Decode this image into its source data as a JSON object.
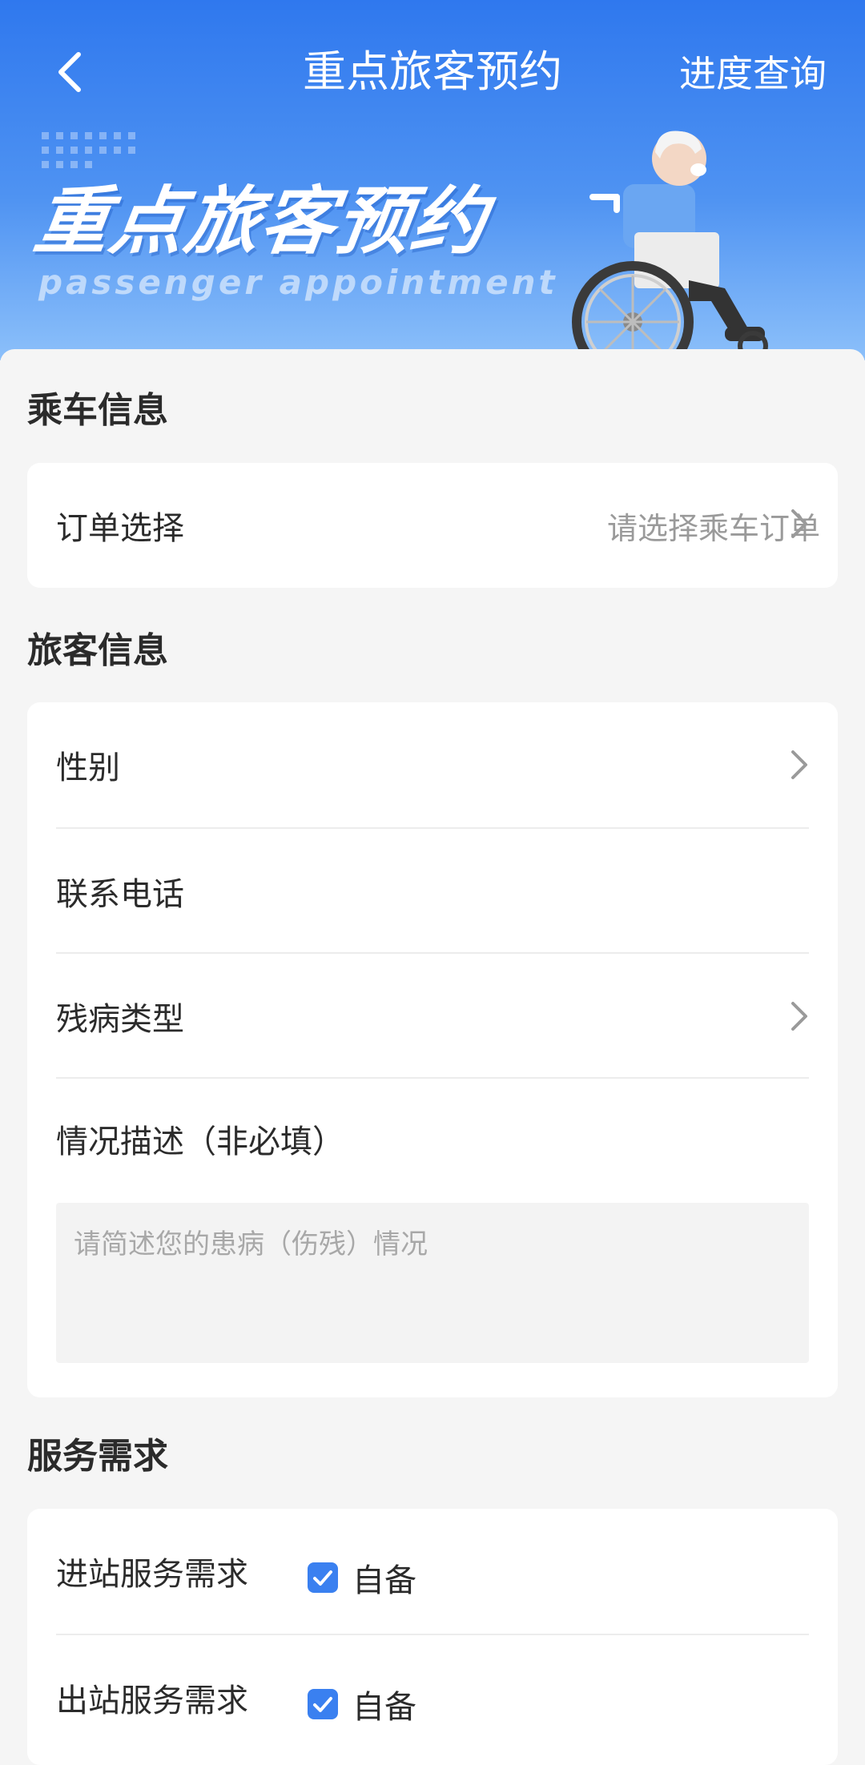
{
  "navbar": {
    "title": "重点旅客预约",
    "right_action": "进度查询"
  },
  "banner": {
    "title": "重点旅客预约",
    "subtitle": "passenger appointment"
  },
  "ride_info": {
    "section_title": "乘车信息",
    "order": {
      "label": "订单选择",
      "placeholder": "请选择乘车订单"
    }
  },
  "passenger_info": {
    "section_title": "旅客信息",
    "gender_label": "性别",
    "phone_label": "联系电话",
    "disability_label": "残病类型",
    "description_label": "情况描述（非必填）",
    "description_placeholder": "请简述您的患病（伤残）情况"
  },
  "service": {
    "section_title": "服务需求",
    "entry": {
      "label": "进站服务需求",
      "option": "自备",
      "checked": true
    },
    "exit": {
      "label": "出站服务需求",
      "option": "自备",
      "checked": true
    }
  },
  "colors": {
    "header_top": "#2f78ee",
    "accent": "#3a80f0",
    "background": "#f5f5f5"
  }
}
